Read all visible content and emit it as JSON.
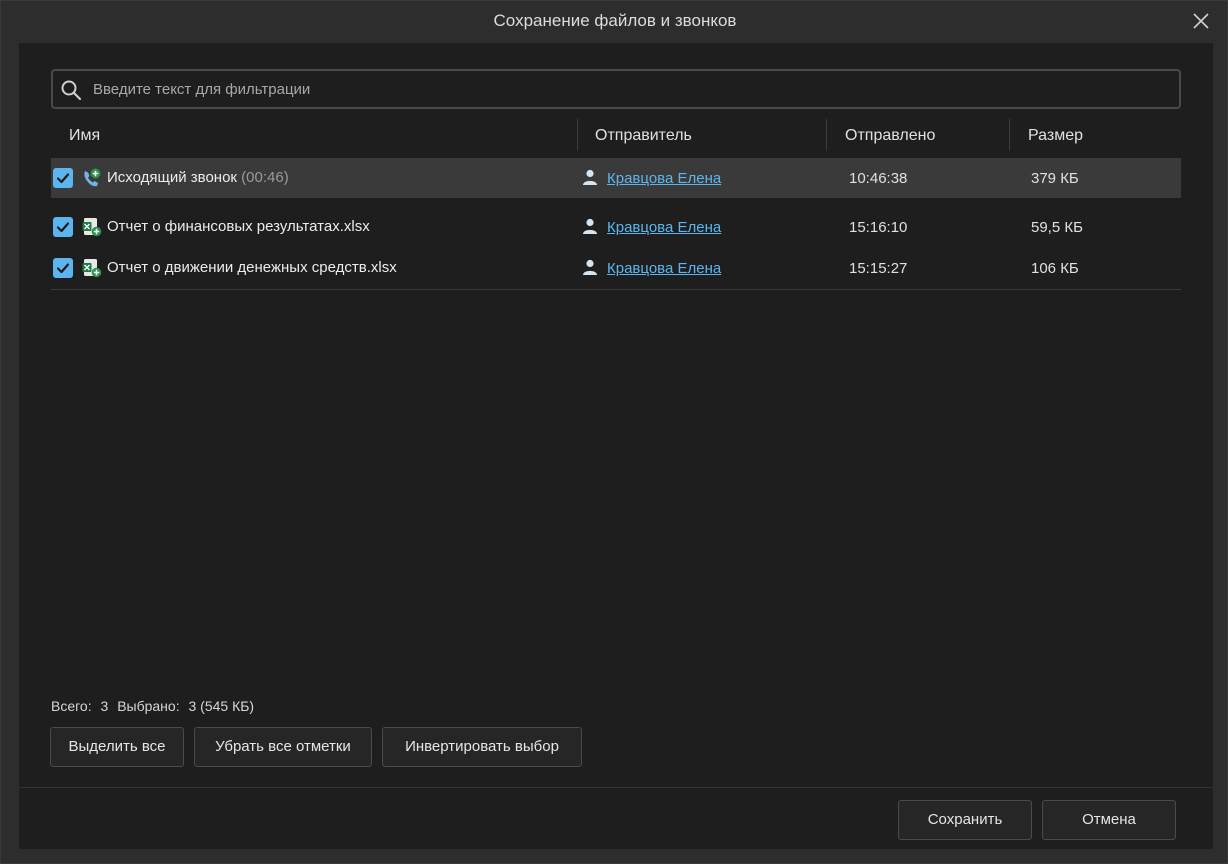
{
  "window": {
    "title": "Сохранение файлов и звонков"
  },
  "search": {
    "placeholder": "Введите текст для фильтрации",
    "value": ""
  },
  "columns": [
    "Имя",
    "Отправитель",
    "Отправлено",
    "Размер"
  ],
  "rows": [
    {
      "name": "Исходящий звонок",
      "duration": "(00:46)",
      "type_icon": "outgoing-call-icon",
      "checked": true,
      "sender": "Кравцова Елена",
      "sent": "10:46:38",
      "size": "379 КБ",
      "selected": true
    },
    {
      "name": "Отчет о финансовых результатах.xlsx",
      "duration": "",
      "type_icon": "excel-file-icon",
      "checked": true,
      "sender": "Кравцова Елена",
      "sent": "15:16:10",
      "size": "59,5 КБ",
      "selected": false
    },
    {
      "name": "Отчет о движении денежных средств.xlsx",
      "duration": "",
      "type_icon": "excel-file-icon",
      "checked": true,
      "sender": "Кравцова Елена",
      "sent": "15:15:27",
      "size": "106 КБ",
      "selected": false
    }
  ],
  "summary": {
    "total_label": "Всего:",
    "total_value": "3",
    "selected_label": "Выбрано:",
    "selected_value": "3 (545 КБ)"
  },
  "actions": {
    "select_all": "Выделить все",
    "clear_all": "Убрать все отметки",
    "invert": "Инвертировать выбор"
  },
  "footer": {
    "save": "Сохранить",
    "cancel": "Отмена"
  },
  "colors": {
    "accent": "#5bb6f0",
    "background": "#1e1e1e",
    "selected_row": "#3a3a3a"
  }
}
